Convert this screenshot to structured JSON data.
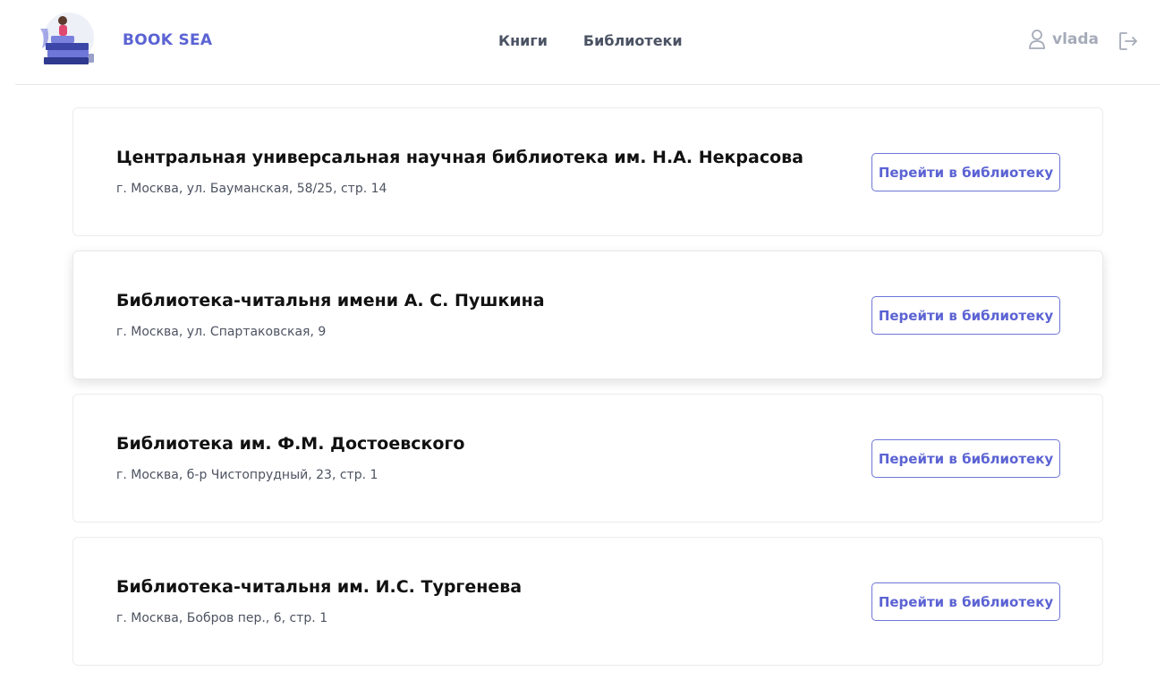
{
  "header": {
    "brand": "BOOK SEA",
    "nav": [
      "Книги",
      "Библиотеки"
    ],
    "user_name": "vlada",
    "icons": {
      "user": "user-icon",
      "logout": "logout-icon",
      "logo": "book-stack-logo"
    }
  },
  "libraries": [
    {
      "name": "Центральная универсальная научная библиотека им. Н.А. Некрасова",
      "address": "г. Москва, ул. Бауманская, 58/25, стр. 14",
      "button": "Перейти в библиотеку"
    },
    {
      "name": "Библиотека-читальня имени А. С. Пушкина",
      "address": "г. Москва, ул. Спартаковская, 9",
      "button": "Перейти в библиотеку"
    },
    {
      "name": "Библиотека им. Ф.М. Достоевского",
      "address": "г. Москва, б-р Чистопрудный, 23, стр. 1",
      "button": "Перейти в библиотеку"
    },
    {
      "name": "Библиотека-читальня им. И.С. Тургенева",
      "address": "г. Москва, Бобров пер., 6, стр. 1",
      "button": "Перейти в библиотеку"
    }
  ],
  "colors": {
    "accent": "#5b63d3",
    "nav_text": "#4a5263",
    "muted": "#a5abb8"
  }
}
